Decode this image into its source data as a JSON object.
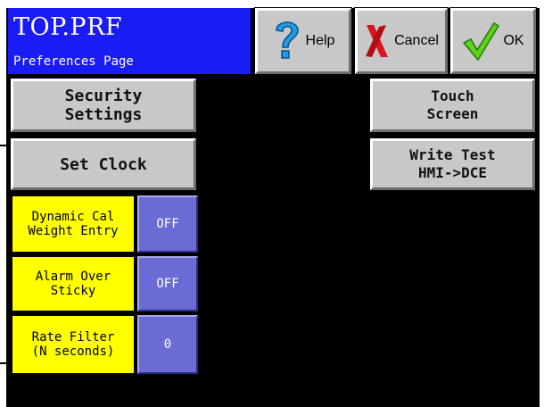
{
  "header": {
    "title": "TOP.PRF",
    "subtitle": "Preferences Page"
  },
  "toolbar": {
    "help_label": "Help",
    "cancel_label": "Cancel",
    "ok_label": "OK"
  },
  "buttons": {
    "security": "Security\nSettings",
    "set_clock": "Set Clock",
    "touch_screen": "Touch\nScreen",
    "write_test": "Write Test\nHMI->DCE"
  },
  "settings": [
    {
      "label": "Dynamic Cal\nWeight Entry",
      "value": "OFF"
    },
    {
      "label": "Alarm Over\nSticky",
      "value": "OFF"
    },
    {
      "label": "Rate Filter\n(N seconds)",
      "value": "0"
    }
  ],
  "colors": {
    "title_bg": "#1a1cf4",
    "button_gray": "#c8c8c8",
    "label_yellow": "#ffff00",
    "value_blue": "#6a6bd4",
    "screen_bg": "#000000"
  },
  "icons": {
    "help": "question-mark-icon",
    "cancel": "red-x-icon",
    "ok": "green-checkmark-icon"
  }
}
